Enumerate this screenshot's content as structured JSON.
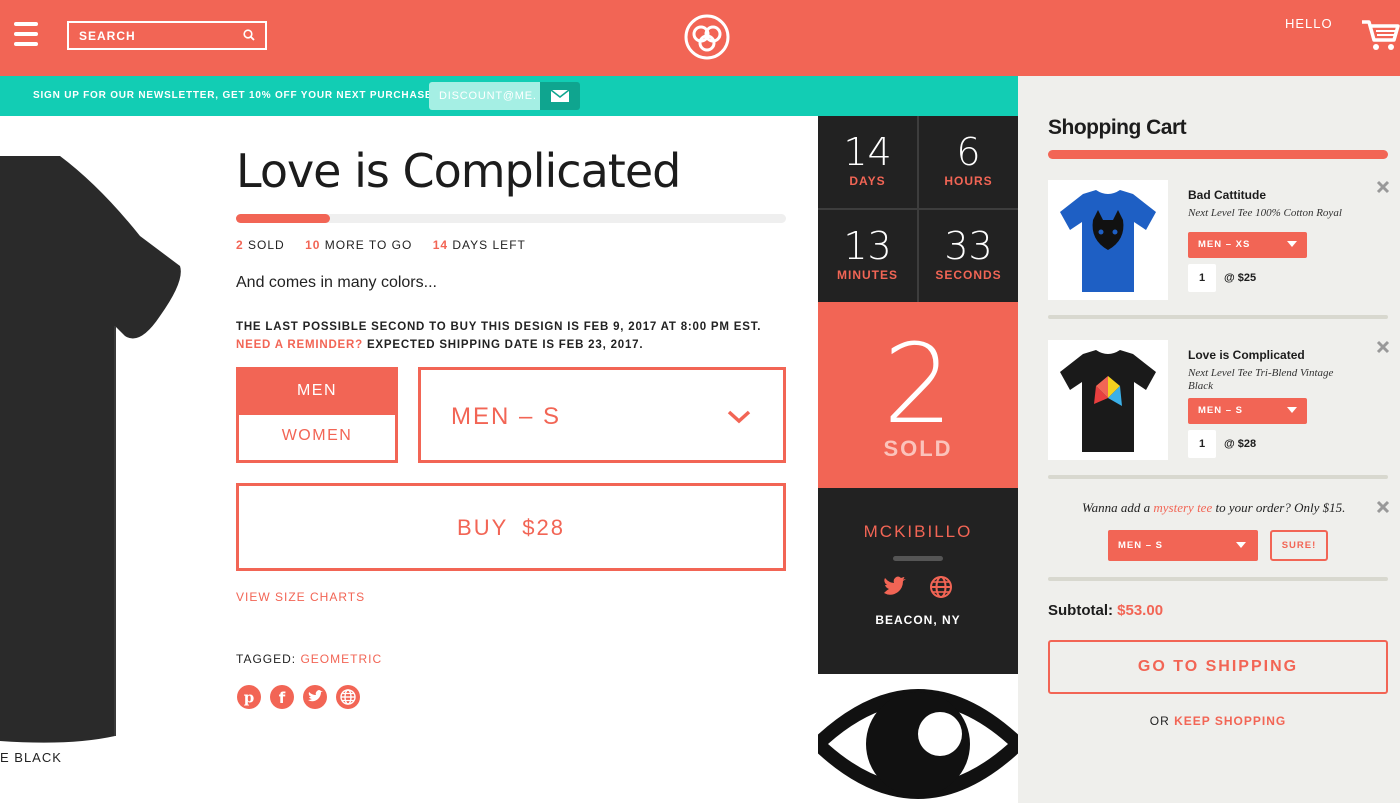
{
  "header": {
    "search_label": "SEARCH",
    "greeting": "HELLO",
    "brand_color": "#f26555"
  },
  "newsletter": {
    "text": "SIGN UP FOR OUR NEWSLETTER, GET 10% OFF YOUR NEXT PURCHASE:",
    "input_placeholder": "DISCOUNT@ME.",
    "accent_color": "#12cdb4"
  },
  "product": {
    "image_caption": "E BLACK",
    "title": "Love is Complicated",
    "progress": 0.17,
    "stats": {
      "sold_num": "2",
      "sold_label": "SOLD",
      "more_num": "10",
      "more_label": "MORE TO GO",
      "days_num": "14",
      "days_label": "DAYS LEFT"
    },
    "colors_text": "And comes in many colors...",
    "deadline_line1": "THE LAST POSSIBLE SECOND TO BUY THIS DESIGN IS FEB 9, 2017 AT 8:00 PM EST.",
    "reminder_link": "NEED A REMINDER?",
    "shipping_text": " EXPECTED SHIPPING DATE IS FEB 23, 2017.",
    "gender_options": [
      "MEN",
      "WOMEN"
    ],
    "selected_size": "MEN – S",
    "buy_label": "BUY",
    "buy_price": "$28",
    "size_charts": "VIEW SIZE CHARTS",
    "tagged_label": "TAGGED: ",
    "tag": "GEOMETRIC",
    "share_icons": [
      "pinterest-icon",
      "facebook-icon",
      "twitter-icon",
      "globe-icon"
    ]
  },
  "countdown": {
    "days": "14",
    "days_label": "DAYS",
    "hours": "6",
    "hours_label": "HOURS",
    "minutes": "13",
    "minutes_label": "MINUTES",
    "seconds": "33",
    "seconds_label": "SECONDS"
  },
  "sold": {
    "count": "2",
    "label": "SOLD"
  },
  "artist": {
    "name": "MCKIBILLO",
    "location": "BEACON, NY"
  },
  "cart": {
    "title": "Shopping Cart",
    "items": [
      {
        "name": "Bad Cattitude",
        "desc": "Next Level Tee 100% Cotton Royal",
        "size": "MEN – XS",
        "qty": "1",
        "price": "@ $25",
        "shirt_color": "#1e5fc4"
      },
      {
        "name": "Love is Complicated",
        "desc": "Next Level Tee Tri-Blend Vintage Black",
        "size": "MEN – S",
        "qty": "1",
        "price": "@ $28",
        "shirt_color": "#1a1a1a"
      }
    ],
    "mystery_pre": "Wanna add a ",
    "mystery_link": "mystery tee",
    "mystery_post": " to your order? Only $15.",
    "mystery_size": "MEN – S",
    "mystery_button": "SURE!",
    "subtotal_label": "Subtotal: ",
    "subtotal_amount": "$53.00",
    "shipping_button": "GO TO SHIPPING",
    "or_label": "OR ",
    "keep_shopping": "KEEP SHOPPING"
  }
}
